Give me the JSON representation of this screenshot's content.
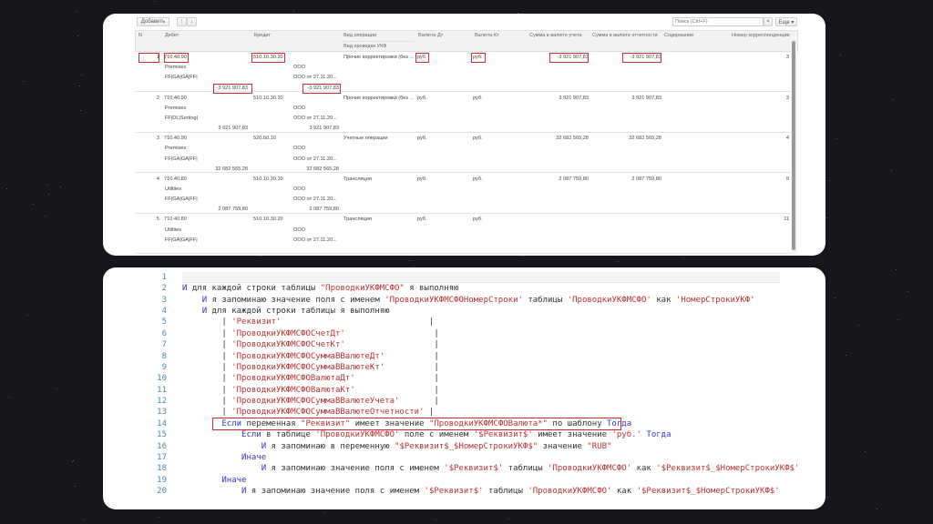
{
  "toolbar": {
    "add_label": "Добавить",
    "up_icon": "arrow-up-icon",
    "down_icon": "arrow-down-icon",
    "search_placeholder": "Поиск (Ctrl+F)",
    "clear_label": "×",
    "more_label": "Еще ▾"
  },
  "table": {
    "headers": {
      "n": "N",
      "debit": "Дебет",
      "credit": "Кредит",
      "op": "Вид операции",
      "op_sub": "Вид проводки УКФ",
      "cur_dt": "Валюта Дт",
      "cur_kt": "Валюта Кт",
      "sum_acc": "Сумма в валюте учета",
      "sum_rep": "Сумма в валюте отчетности",
      "content": "Содержание",
      "corr": "Номер корреспонденции"
    },
    "rows": [
      {
        "n": "1",
        "debit": "710.40.90",
        "credit": "510.10.30.20",
        "op": "Прочие корректировки (без ...",
        "cur_dt": "руб.",
        "cur_kt": "руб.",
        "sum_acc": "-3 921 907,83",
        "sum_rep": "-3 921 907,83",
        "corr": "3",
        "debit2": "Premises",
        "credit2": "ООО",
        "debit3": "FF|GA|GA|FF|",
        "credit3": "ООО от 27.11.20...",
        "debit_amt": "-3 921 907,83",
        "credit_amt": "-3 921 907,83",
        "highlighted": true
      },
      {
        "n": "2",
        "debit": "710.40.90",
        "credit": "510.10.30.20",
        "op": "Прочие корректировки (без ...",
        "cur_dt": "руб.",
        "cur_kt": "руб.",
        "sum_acc": "3 921 907,83",
        "sum_rep": "3 921 907,83",
        "corr": "3",
        "debit2": "Premises",
        "credit2": "ООО",
        "debit3": "FF|DL|Sorting|",
        "credit3": "ООО от 27.11.20...",
        "debit_amt": "3 921 907,83",
        "credit_amt": "3 921 907,83"
      },
      {
        "n": "3",
        "debit": "710.40.90",
        "credit": "520.60.10",
        "op": "Учетные операции",
        "cur_dt": "руб.",
        "cur_kt": "руб.",
        "sum_acc": "32 682 565,28",
        "sum_rep": "32 682 565,28",
        "corr": "4",
        "debit2": "Premises",
        "credit2": "ООО",
        "debit3": "FF|GA|GA|FF|",
        "credit3": "ООО от 27.11.20...",
        "debit_amt": "32 682 565,28",
        "credit_amt": "32 682 565,28"
      },
      {
        "n": "4",
        "debit": "710.40.80",
        "credit": "510.10.30.10",
        "op": "Трансляция",
        "cur_dt": "руб.",
        "cur_kt": "руб.",
        "sum_acc": "2 087 759,80",
        "sum_rep": "2 087 759,80",
        "corr": "9",
        "debit2": "Utilities",
        "credit2": "ООО",
        "debit3": "FF|GA|GA|FF|",
        "credit3": "ООО от 27.11.20...",
        "debit_amt": "2 087 759,80",
        "credit_amt": "2 087 759,80"
      },
      {
        "n": "5",
        "debit": "710.40.80",
        "credit": "510.10.30.20",
        "op": "Трансляция",
        "cur_dt": "руб.",
        "cur_kt": "руб.",
        "sum_acc": "",
        "sum_rep": "",
        "corr": "11",
        "debit2": "Utilities",
        "credit2": "ООО",
        "debit3": "FF|GA|GA|FF|",
        "credit3": "ООО от 27.11.20...",
        "debit_amt": "",
        "credit_amt": ""
      }
    ]
  },
  "code": {
    "highlight_line": 14,
    "lines": [
      [],
      [
        [
          "kw",
          "И"
        ],
        [
          "txt",
          " для каждой строки таблицы "
        ],
        [
          "str",
          "\"ПроводкиУКФМСФО\""
        ],
        [
          "txt",
          " я выполняю"
        ]
      ],
      [
        [
          "txt",
          "    "
        ],
        [
          "kw",
          "И"
        ],
        [
          "txt",
          " я запоминаю значение поля с именем "
        ],
        [
          "str",
          "'ПроводкиУКФМСФОНомерСтроки'"
        ],
        [
          "txt",
          " таблицы "
        ],
        [
          "str",
          "'ПроводкиУКФМСФО'"
        ],
        [
          "txt",
          " как "
        ],
        [
          "str",
          "'НомерСтрокиУКФ'"
        ]
      ],
      [
        [
          "txt",
          "    "
        ],
        [
          "kw",
          "И"
        ],
        [
          "txt",
          " для каждой строки таблицы я выполняю"
        ]
      ],
      [
        [
          "txt",
          "        | "
        ],
        [
          "str",
          "'Реквизит'"
        ],
        [
          "txt",
          "                              |"
        ]
      ],
      [
        [
          "txt",
          "        | "
        ],
        [
          "str",
          "'ПроводкиУКФМСФОСчетДт'"
        ],
        [
          "txt",
          "                  |"
        ]
      ],
      [
        [
          "txt",
          "        | "
        ],
        [
          "str",
          "'ПроводкиУКФМСФОСчетКт'"
        ],
        [
          "txt",
          "                  |"
        ]
      ],
      [
        [
          "txt",
          "        | "
        ],
        [
          "str",
          "'ПроводкиУКФМСФОСуммаВВалютеДт'"
        ],
        [
          "txt",
          "          |"
        ]
      ],
      [
        [
          "txt",
          "        | "
        ],
        [
          "str",
          "'ПроводкиУКФМСФОСуммаВВалютеКт'"
        ],
        [
          "txt",
          "          |"
        ]
      ],
      [
        [
          "txt",
          "        | "
        ],
        [
          "str",
          "'ПроводкиУКФМСФОВалютаДт'"
        ],
        [
          "txt",
          "                |"
        ]
      ],
      [
        [
          "txt",
          "        | "
        ],
        [
          "str",
          "'ПроводкиУКФМСФОВалютаКт'"
        ],
        [
          "txt",
          "                |"
        ]
      ],
      [
        [
          "txt",
          "        | "
        ],
        [
          "str",
          "'ПроводкиУКФМСФОСуммаВВалютеУчета'"
        ],
        [
          "txt",
          "       |"
        ]
      ],
      [
        [
          "txt",
          "        | "
        ],
        [
          "str",
          "'ПроводкиУКФМСФОСуммаВВалютеОтчетности'"
        ],
        [
          "txt",
          " |"
        ]
      ],
      [
        [
          "txt",
          "        "
        ],
        [
          "kw",
          "Если"
        ],
        [
          "txt",
          " переменная "
        ],
        [
          "str",
          "\"Реквизит\""
        ],
        [
          "txt",
          " имеет значение "
        ],
        [
          "str",
          "\"ПроводкиУКФМСФОВалюта*\""
        ],
        [
          "txt",
          " по шаблону "
        ],
        [
          "kw",
          "Тогда"
        ]
      ],
      [
        [
          "txt",
          "            "
        ],
        [
          "kw",
          "Если"
        ],
        [
          "txt",
          " в таблице "
        ],
        [
          "str",
          "'ПроводкиУКФМСФО'"
        ],
        [
          "txt",
          " поле с именем "
        ],
        [
          "str",
          "'$Реквизит$'"
        ],
        [
          "txt",
          " имеет значение "
        ],
        [
          "str",
          "'руб.'"
        ],
        [
          "txt",
          " "
        ],
        [
          "kw",
          "Тогда"
        ]
      ],
      [
        [
          "txt",
          "                "
        ],
        [
          "kw",
          "И"
        ],
        [
          "txt",
          " я запоминаю в переменную "
        ],
        [
          "str",
          "\"$Реквизит$_$НомерСтрокиУКФ$\""
        ],
        [
          "txt",
          " значение "
        ],
        [
          "str",
          "\"RUB\""
        ]
      ],
      [
        [
          "txt",
          "            "
        ],
        [
          "kw",
          "Иначе"
        ]
      ],
      [
        [
          "txt",
          "                "
        ],
        [
          "kw",
          "И"
        ],
        [
          "txt",
          " я запоминаю значение поля с именем "
        ],
        [
          "str",
          "'$Реквизит$'"
        ],
        [
          "txt",
          " таблицы "
        ],
        [
          "str",
          "'ПроводкиУКФМСФО'"
        ],
        [
          "txt",
          " как "
        ],
        [
          "str",
          "'$Реквизит$_$НомерСтрокиУКФ$'"
        ]
      ],
      [
        [
          "txt",
          "        "
        ],
        [
          "kw",
          "Иначе"
        ]
      ],
      [
        [
          "txt",
          "            "
        ],
        [
          "kw",
          "И"
        ],
        [
          "txt",
          " я запоминаю значение поля с именем "
        ],
        [
          "str",
          "'$Реквизит$'"
        ],
        [
          "txt",
          " таблицы "
        ],
        [
          "str",
          "'ПроводкиУКФМСФО'"
        ],
        [
          "txt",
          " как "
        ],
        [
          "str",
          "'$Реквизит$_$НомерСтрокиУКФ$'"
        ]
      ]
    ]
  },
  "colors": {
    "background": "#15171c",
    "highlight": "#d12a2a",
    "keyword": "#3535c8",
    "string": "#b83232",
    "line_number": "#4a8ab0"
  }
}
